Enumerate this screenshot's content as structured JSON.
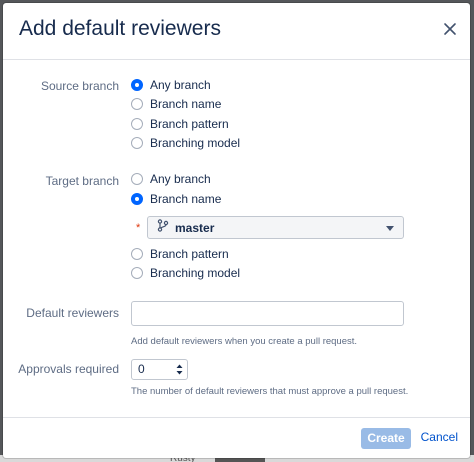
{
  "dialog": {
    "title": "Add default reviewers"
  },
  "source_branch": {
    "label": "Source branch",
    "options": [
      "Any branch",
      "Branch name",
      "Branch pattern",
      "Branching model"
    ],
    "selected": "Any branch"
  },
  "target_branch": {
    "label": "Target branch",
    "options": [
      "Any branch",
      "Branch name",
      "Branch pattern",
      "Branching model"
    ],
    "selected": "Branch name",
    "branch_select": {
      "required_marker": "*",
      "value": "master"
    }
  },
  "default_reviewers": {
    "label": "Default reviewers",
    "value": "",
    "help": "Add default reviewers when you create a pull request."
  },
  "approvals": {
    "label": "Approvals required",
    "value": "0",
    "help": "The number of default reviewers that must approve a pull request."
  },
  "footer": {
    "create_label": "Create",
    "cancel_label": "Cancel"
  },
  "background": {
    "partial_text": "Rusty"
  },
  "colors": {
    "accent": "#0065ff",
    "link": "#0052cc",
    "disabled_button": "#99bbe6",
    "required": "#de350b"
  }
}
